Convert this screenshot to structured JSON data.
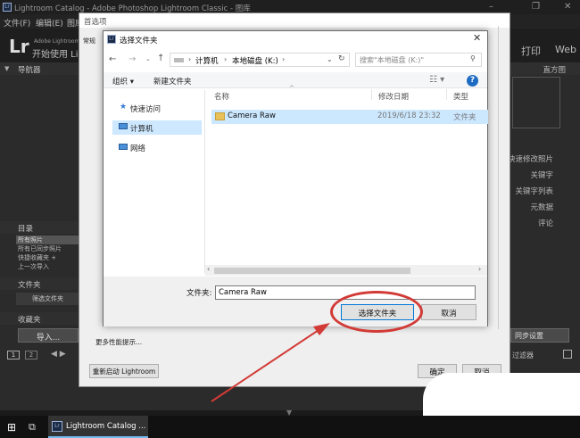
{
  "window": {
    "title": "Lightroom Catalog - Adobe Photoshop Lightroom Classic - 图库",
    "menus": [
      "文件(F)",
      "编辑(E)",
      "图库"
    ],
    "win_controls": [
      "–",
      "❐",
      "✕"
    ]
  },
  "lr": {
    "logo": "Lr",
    "subtitle1": "Adobe Lightroom C",
    "subtitle2": "开始使用 Li",
    "modules": [
      "打印",
      "Web"
    ],
    "left": {
      "navigator": "导航器",
      "catalog": "目录",
      "catalog_items": [
        "所有照片",
        "所有已同步照片",
        "快捷收藏夹 +",
        "上一次导入"
      ],
      "folders": "文件夹",
      "filter_folders": "筛选文件夹",
      "collections": "收藏夹",
      "import": "导入..."
    },
    "right": {
      "histogram": "直方图",
      "items": [
        "快速修改照片",
        "关键字",
        "关键字列表",
        "元数据",
        "评论"
      ],
      "sync": "同步设置",
      "filter": "过滤器"
    },
    "filmstrip": [
      "1",
      "2"
    ]
  },
  "prefs": {
    "title": "首选项",
    "side_labels": [
      "常规"
    ],
    "perf_link": "更多性能提示...",
    "restart": "重新启动 Lightroom",
    "ok": "确定",
    "cancel": "取消"
  },
  "dialog": {
    "title": "选择文件夹",
    "breadcrumb": [
      "计算机",
      "本地磁盘 (K:)"
    ],
    "search_placeholder": "搜索\"本地磁盘 (K:)\"",
    "organize": "组织 ▾",
    "new_folder": "新建文件夹",
    "nav": [
      "快速访问",
      "计算机",
      "网络"
    ],
    "columns": {
      "name": "名称",
      "date": "修改日期",
      "type": "类型"
    },
    "files": [
      {
        "name": "Camera Raw",
        "date": "2019/6/18 23:32",
        "type": "文件夹"
      }
    ],
    "folder_label": "文件夹:",
    "folder_value": "Camera Raw",
    "select_button": "选择文件夹",
    "cancel_button": "取消"
  },
  "taskbar": {
    "app": "Lightroom Catalog ..."
  },
  "colors": {
    "highlight": "#d23a36",
    "selection": "#cce8ff"
  }
}
